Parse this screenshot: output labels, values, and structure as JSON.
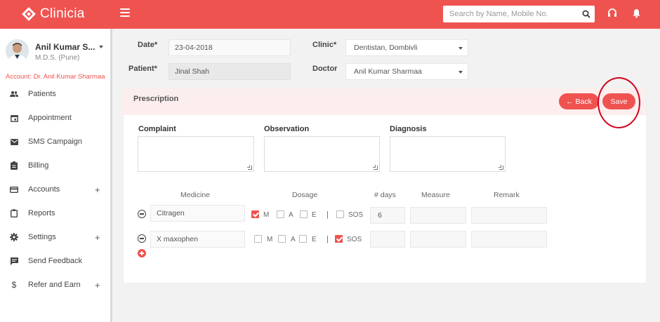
{
  "header": {
    "app_name": "Clinicia",
    "search_placeholder": "Search by Name, Mobile No.",
    "brand_color": "#ef5350"
  },
  "sidebar": {
    "user_name": "Anil Kumar S...",
    "user_degree": "M.D.S. (Pune)",
    "account_line": "Account: Dr. Anil Kumar Sharmaa",
    "items": [
      {
        "label": "Patients",
        "icon": "people-icon"
      },
      {
        "label": "Appointment",
        "icon": "calendar-icon"
      },
      {
        "label": "SMS Campaign",
        "icon": "envelope-icon"
      },
      {
        "label": "Billing",
        "icon": "clipboard-icon"
      },
      {
        "label": "Accounts",
        "icon": "card-icon",
        "expandable": "+"
      },
      {
        "label": "Reports",
        "icon": "report-icon"
      },
      {
        "label": "Settings",
        "icon": "gear-icon",
        "expandable": "+"
      },
      {
        "label": "Send Feedback",
        "icon": "feedback-icon"
      },
      {
        "label": "Refer and Earn",
        "icon": "dollar-icon",
        "expandable": "+"
      }
    ]
  },
  "form": {
    "date_label": "Date*",
    "date_value": "23-04-2018",
    "patient_label": "Patient*",
    "patient_value": "Jinal Shah",
    "clinic_label": "Clinic*",
    "clinic_value": "Dentistan, Dombivli",
    "doctor_label": "Doctor",
    "doctor_value": "Anil Kumar Sharmaa"
  },
  "prescription": {
    "title": "Prescription",
    "back_label": "← Back",
    "save_label": "Save",
    "complaint_label": "Complaint",
    "observation_label": "Observation",
    "diagnosis_label": "Diagnosis",
    "columns": {
      "medicine": "Medicine",
      "dosage": "Dosage",
      "days": "# days",
      "measure": "Measure",
      "remark": "Remark"
    },
    "dosage_labels": {
      "m": "M",
      "a": "A",
      "e": "E",
      "sos": "SOS",
      "separator": "|"
    },
    "rows": [
      {
        "medicine": "Citragen",
        "m": true,
        "a": false,
        "e": false,
        "sos": false,
        "days": "6",
        "measure": "",
        "remark": ""
      },
      {
        "medicine": "X maxophen",
        "m": false,
        "a": false,
        "e": false,
        "sos": true,
        "days": "",
        "measure": "",
        "remark": ""
      }
    ]
  }
}
